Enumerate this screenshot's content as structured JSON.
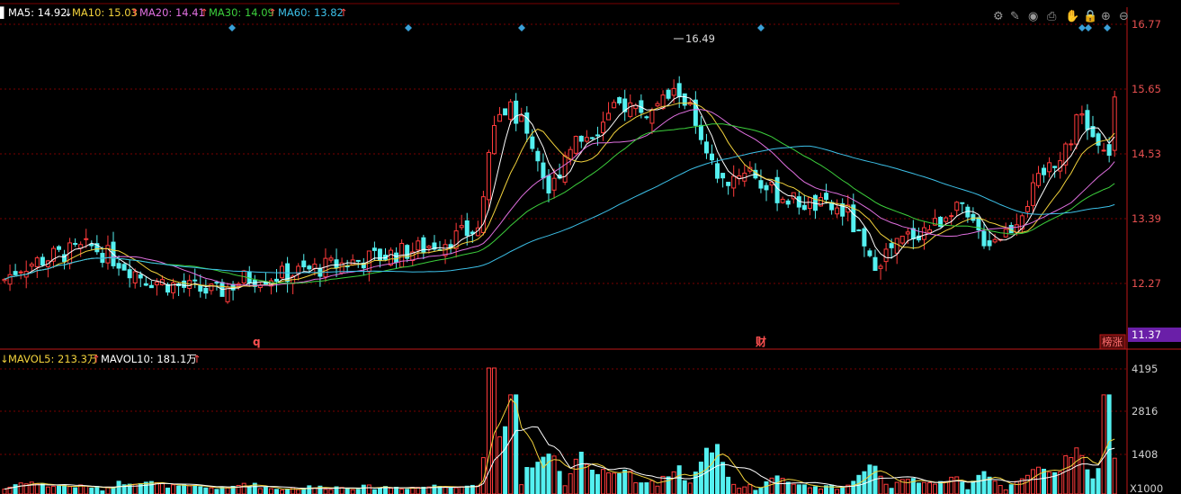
{
  "legend": {
    "ma5": {
      "label": "MA5: 14.92",
      "arrow": "↓",
      "color": "#ffffff"
    },
    "ma10": {
      "label": "MA10: 15.03",
      "arrow": "↑",
      "color": "#f2d23c"
    },
    "ma20": {
      "label": "MA20: 14.41",
      "arrow": "↑",
      "color": "#e070e0"
    },
    "ma30": {
      "label": "MA30: 14.09",
      "arrow": "↑",
      "color": "#3ccf3c"
    },
    "ma60": {
      "label": "MA60: 13.82",
      "arrow": "↑",
      "color": "#3cc0e8"
    }
  },
  "vol_legend": {
    "mavol5": {
      "label": "MAVOL5: 213.3万",
      "arrow": "↑",
      "color": "#f2d23c"
    },
    "mavol10": {
      "label": "MAVOL10: 181.1万",
      "arrow": "↑",
      "color": "#ffffff"
    }
  },
  "toolbar": {
    "icons": [
      "gear-icon",
      "brush-icon",
      "eye-icon",
      "print-icon",
      "hand-icon",
      "lock-icon",
      "zoom-in-icon",
      "zoom-out-icon"
    ],
    "glyphs": [
      "⚙",
      "✎",
      "◉",
      "⎙",
      "✋",
      "🔒",
      "⊕",
      "⊖"
    ]
  },
  "markers": {
    "left": "q",
    "mid": "财"
  },
  "badges": {
    "rank": "榜涨",
    "last_price": "11.37"
  },
  "peak_label": "16.49",
  "colors": {
    "up": "#ff3b3b",
    "down": "#54f0f0",
    "grid": "#7a0000",
    "axis_text": "#e85050",
    "badge_bg": "#6a1fa8"
  },
  "chart_data": [
    {
      "type": "candlestick",
      "y_ticks": [
        "16.77",
        "15.65",
        "14.53",
        "13.39",
        "12.27"
      ],
      "y_min_label": "11.37",
      "ylim": [
        11.37,
        16.77
      ],
      "peak_high": 16.49,
      "ma_last": {
        "MA5": 14.92,
        "MA10": 15.03,
        "MA20": 14.41,
        "MA30": 14.09,
        "MA60": 13.82
      }
    },
    {
      "type": "bar",
      "y_ticks": [
        "4195",
        "2816",
        "1408"
      ],
      "unit_label": "X1000",
      "mavol_last": {
        "MAVOL5": "213.3万",
        "MAVOL10": "181.1万"
      }
    }
  ]
}
